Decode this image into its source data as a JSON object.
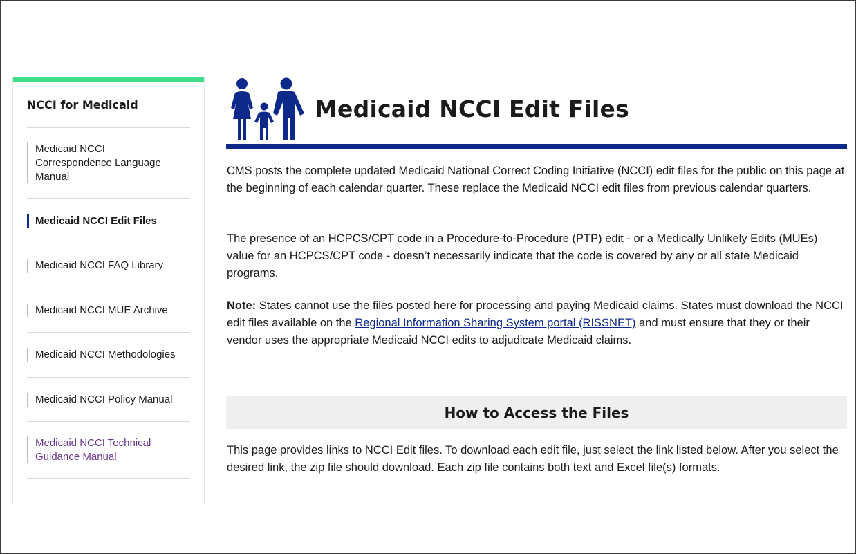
{
  "sidebar": {
    "title": "NCCI for Medicaid",
    "items": [
      {
        "label": "Medicaid NCCI Correspondence Language Manual",
        "state": "default"
      },
      {
        "label": "Medicaid NCCI Edit Files",
        "state": "active"
      },
      {
        "label": "Medicaid NCCI FAQ Library",
        "state": "default"
      },
      {
        "label": "Medicaid NCCI MUE Archive",
        "state": "default"
      },
      {
        "label": "Medicaid NCCI Methodologies",
        "state": "default"
      },
      {
        "label": "Medicaid NCCI Policy Manual",
        "state": "default"
      },
      {
        "label": "Medicaid NCCI Technical Guidance Manual",
        "state": "visited"
      }
    ]
  },
  "main": {
    "title": "Medicaid NCCI Edit Files",
    "icon": "family-icon",
    "paragraph1": "CMS posts the complete updated Medicaid National Correct Coding Initiative (NCCI) edit files for the public on this page at the beginning of each calendar quarter. These replace the Medicaid NCCI edit files from previous calendar quarters.",
    "paragraph2": "The presence of an HCPCS/CPT code in a Procedure-to-Procedure (PTP) edit - or a Medically Unlikely Edits (MUEs) value for an HCPCS/CPT code - doesn’t necessarily indicate that the code is covered by any or all state Medicaid programs.",
    "note": {
      "label": "Note:",
      "text_before": " States cannot use the files posted here for processing and paying Medicaid claims. States must download the NCCI edit files available on the ",
      "link_text": "Regional Information Sharing System portal (RISSNET)",
      "text_after": " and must ensure that they or their vendor uses the appropriate Medicaid NCCI edits to adjudicate Medicaid claims."
    },
    "section_heading": "How to Access the Files",
    "paragraph4": "This page provides links to NCCI Edit files. To download each edit file, just select the link listed below. After you select the desired link, the zip file should download. Each zip file contains both text and Excel file(s) formats."
  },
  "colors": {
    "accent_green": "#3fdc8b",
    "brand_navy": "#0d2a8a",
    "visited_purple": "#6a3592",
    "section_band": "#efefef"
  }
}
